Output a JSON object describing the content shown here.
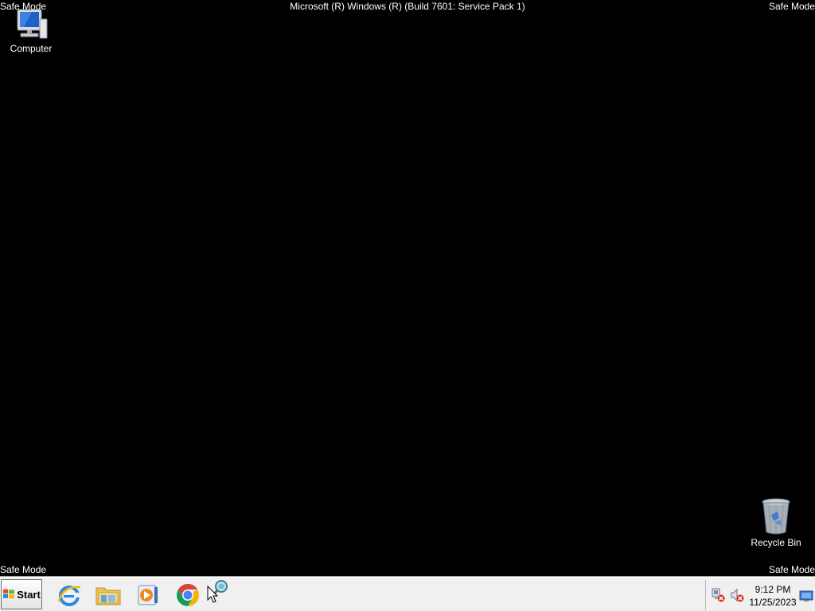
{
  "overlay": {
    "safe_mode_label": "Safe Mode",
    "build_text": "Microsoft (R) Windows (R) (Build 7601: Service Pack 1)"
  },
  "desktop": {
    "icons": [
      {
        "label": "Computer",
        "icon": "computer-icon"
      },
      {
        "label": "Recycle Bin",
        "icon": "recycle-bin-icon"
      }
    ]
  },
  "taskbar": {
    "start_label": "Start",
    "pinned": [
      {
        "name": "Internet Explorer",
        "icon": "internet-explorer-icon"
      },
      {
        "name": "Windows Explorer",
        "icon": "folder-icon"
      },
      {
        "name": "Windows Media Player",
        "icon": "media-player-icon"
      },
      {
        "name": "Google Chrome",
        "icon": "chrome-icon"
      }
    ],
    "tray": {
      "time": "9:12 PM",
      "date": "11/25/2023",
      "icons": [
        "network-disconnected-icon",
        "volume-muted-icon",
        "show-desktop-icon"
      ]
    }
  },
  "colors": {
    "desktop_background": "#000000",
    "taskbar_background": "#f0f0f0",
    "accent_blue": "#1e6fd9"
  }
}
